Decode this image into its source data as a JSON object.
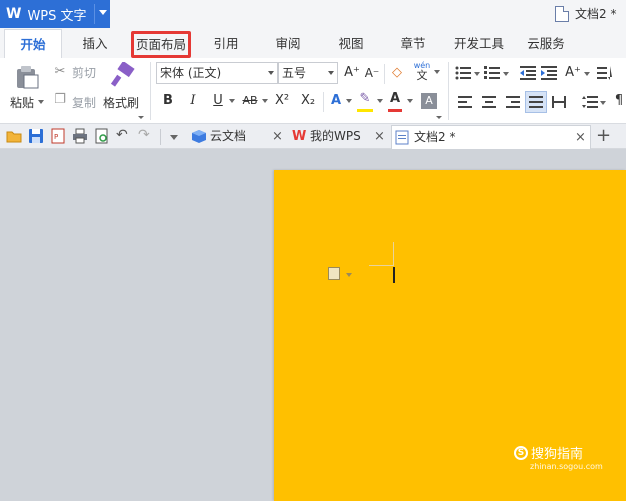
{
  "app": {
    "logo_glyph": "W",
    "title": "WPS 文字"
  },
  "window": {
    "doc_title": "文档2 *"
  },
  "menu": {
    "tabs": [
      {
        "label": "开始",
        "active": true
      },
      {
        "label": "插入"
      },
      {
        "label": "页面布局",
        "highlighted": true
      },
      {
        "label": "引用"
      },
      {
        "label": "审阅"
      },
      {
        "label": "视图"
      },
      {
        "label": "章节"
      },
      {
        "label": "开发工具"
      },
      {
        "label": "云服务"
      }
    ]
  },
  "ribbon": {
    "paste_label": "粘贴",
    "cut_label": "剪切",
    "copy_label": "复制",
    "format_painter_label": "格式刷",
    "font_name": "宋体 (正文)",
    "font_size": "五号",
    "bold": "B",
    "italic": "I",
    "underline": "U",
    "strike": "AB",
    "superscript": "X²",
    "subscript": "X₂",
    "text_effect": "A",
    "font_color": "A",
    "grow_font": "A⁺",
    "shrink_font": "A⁻",
    "pinyin": "wén"
  },
  "doctabs": {
    "tabs": [
      {
        "label": "云文档"
      },
      {
        "label": "我的WPS"
      },
      {
        "label": "文档2 *",
        "active": true
      }
    ],
    "new_tab": "+"
  },
  "page": {
    "background_color": "#ffc000"
  },
  "watermark": {
    "main": "搜狗指南",
    "sub": "zhinan.sogou.com"
  },
  "colors": {
    "brand": "#2d6fd6",
    "highlight_border": "#e53935",
    "page": "#ffc000"
  }
}
